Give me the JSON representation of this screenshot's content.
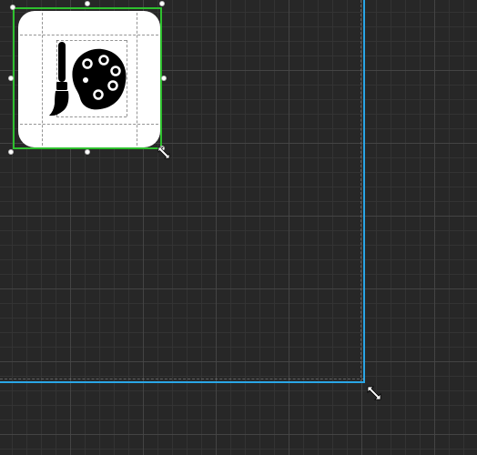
{
  "canvas": {
    "background": "#272727",
    "grid_color": "#464646"
  },
  "artboard": {
    "edge_color": "#2aa6e6"
  },
  "selection": {
    "outline_color": "#2ec02e",
    "handle_color": "#ffffff"
  },
  "selected_object": {
    "icon": "palette-brush-icon",
    "tile_color": "#ffffff",
    "glyph_color": "#000000"
  },
  "cursors": {
    "artboard_resize": "diagonal-resize-cursor-icon",
    "object_resize": "diagonal-resize-cursor-icon"
  }
}
